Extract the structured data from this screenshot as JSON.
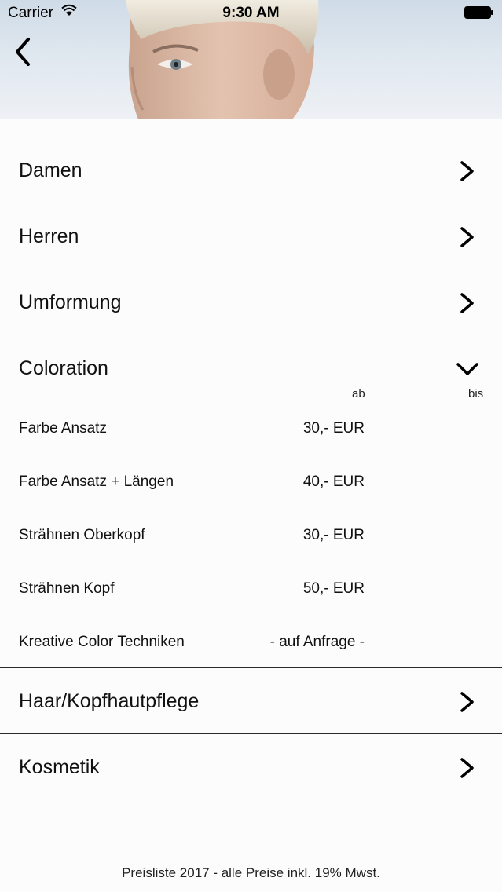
{
  "status": {
    "carrier": "Carrier",
    "time": "9:30 AM"
  },
  "menu": {
    "damen": "Damen",
    "herren": "Herren",
    "umformung": "Umformung",
    "coloration": {
      "label": "Coloration",
      "col_ab": "ab",
      "col_bis": "bis",
      "items": [
        {
          "name": "Farbe Ansatz",
          "price": "30,- EUR"
        },
        {
          "name": "Farbe Ansatz + Längen",
          "price": "40,- EUR"
        },
        {
          "name": "Strähnen Oberkopf",
          "price": "30,- EUR"
        },
        {
          "name": "Strähnen Kopf",
          "price": "50,- EUR"
        },
        {
          "name": "Kreative Color Techniken",
          "price": "- auf Anfrage -"
        }
      ]
    },
    "haar": "Haar/Kopfhautpflege",
    "kosmetik": "Kosmetik"
  },
  "footer": "Preisliste 2017 - alle Preise inkl. 19% Mwst."
}
